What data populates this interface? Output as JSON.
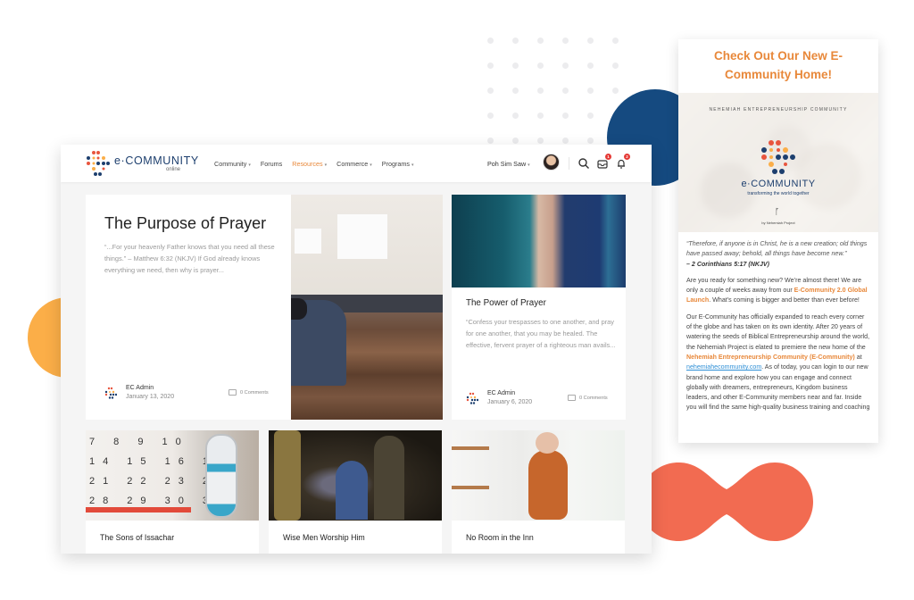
{
  "colors": {
    "accent_orange": "#e8883a",
    "navy": "#154a80",
    "blob_orange": "#fbae48",
    "blob_coral": "#f26b51",
    "badge_red": "#e53935"
  },
  "desktop": {
    "logo": {
      "icon": "e-community-dots-logo",
      "name": "e·COMMUNITY",
      "sub": "online"
    },
    "nav": [
      {
        "label": "Community",
        "has_dropdown": true,
        "active": false
      },
      {
        "label": "Forums",
        "has_dropdown": false,
        "active": false
      },
      {
        "label": "Resources",
        "has_dropdown": true,
        "active": true
      },
      {
        "label": "Commerce",
        "has_dropdown": true,
        "active": false
      },
      {
        "label": "Programs",
        "has_dropdown": true,
        "active": false
      }
    ],
    "caret": "▾",
    "user": {
      "name": "Poh Sim Saw",
      "caret": "▾"
    },
    "icons": {
      "search": "search-icon",
      "inbox": "inbox-icon",
      "bell": "bell-icon"
    },
    "badges": {
      "inbox": "1",
      "notifications": "2"
    },
    "posts": {
      "featured": {
        "title": "The Purpose of Prayer",
        "excerpt": "“...For your heavenly Father knows that you need all these things.” – Matthew 6:32 (NKJV) If God already knows everything we need, then why is prayer...",
        "author": "EC Admin",
        "date": "January 13, 2020",
        "comments": "0 Comments"
      },
      "second": {
        "title": "The Power of Prayer",
        "excerpt": "“Confess your trespasses to one another, and pray for one another, that you may be healed. The effective, fervent prayer of a righteous man avails...",
        "author": "EC Admin",
        "date": "January 6, 2020",
        "comments": "0 Comments"
      },
      "row2": [
        {
          "title": "The Sons of Issachar"
        },
        {
          "title": "Wise Men Worship Him"
        },
        {
          "title": "No Room in the Inn"
        }
      ]
    },
    "calendar_numbers": "7 8 9 10\n14 15 16 17\n21 22 23 24\n28 29 30 31"
  },
  "mobile": {
    "title": "Check Out Our New E-Community Home!",
    "hero": {
      "caption": "NEHEMIAH ENTREPRENEURSHIP COMMUNITY",
      "brand": "e·COMMUNITY",
      "tagline": "transforming the world together",
      "by": "by Nehemiah Project"
    },
    "verse": "“Therefore, if anyone is in Christ, he is a new creation; old things have passed away; behold, all things have become new.”",
    "verse_ref": "– 2 Corinthians 5:17 (NKJV)",
    "p1_a": "Are you ready for something new? We’re almost there! We are only a couple of weeks away from our ",
    "p1_hl": "E-Community 2.0 Global Launch",
    "p1_b": ". What’s coming is bigger and better than ever before!",
    "p2_a": "Our E-Community has officially expanded to reach every corner of the globe and has taken on its own identity. After 20 years of watering the seeds of Biblical Entrepreneurship around the world, the Nehemiah Project is elated to premiere the new home of the ",
    "p2_hl": "Nehemiah Entrepreneurship Community (E-Community)",
    "p2_b": " at ",
    "p2_link": "nehemiahecommunity.com",
    "p2_c": ". As of today, you can login to our new brand home and explore how you can engage and connect globally with dreamers, entrepreneurs, Kingdom business leaders, and other E-Community members near and far. Inside you will find the same high-quality business training and coaching"
  }
}
